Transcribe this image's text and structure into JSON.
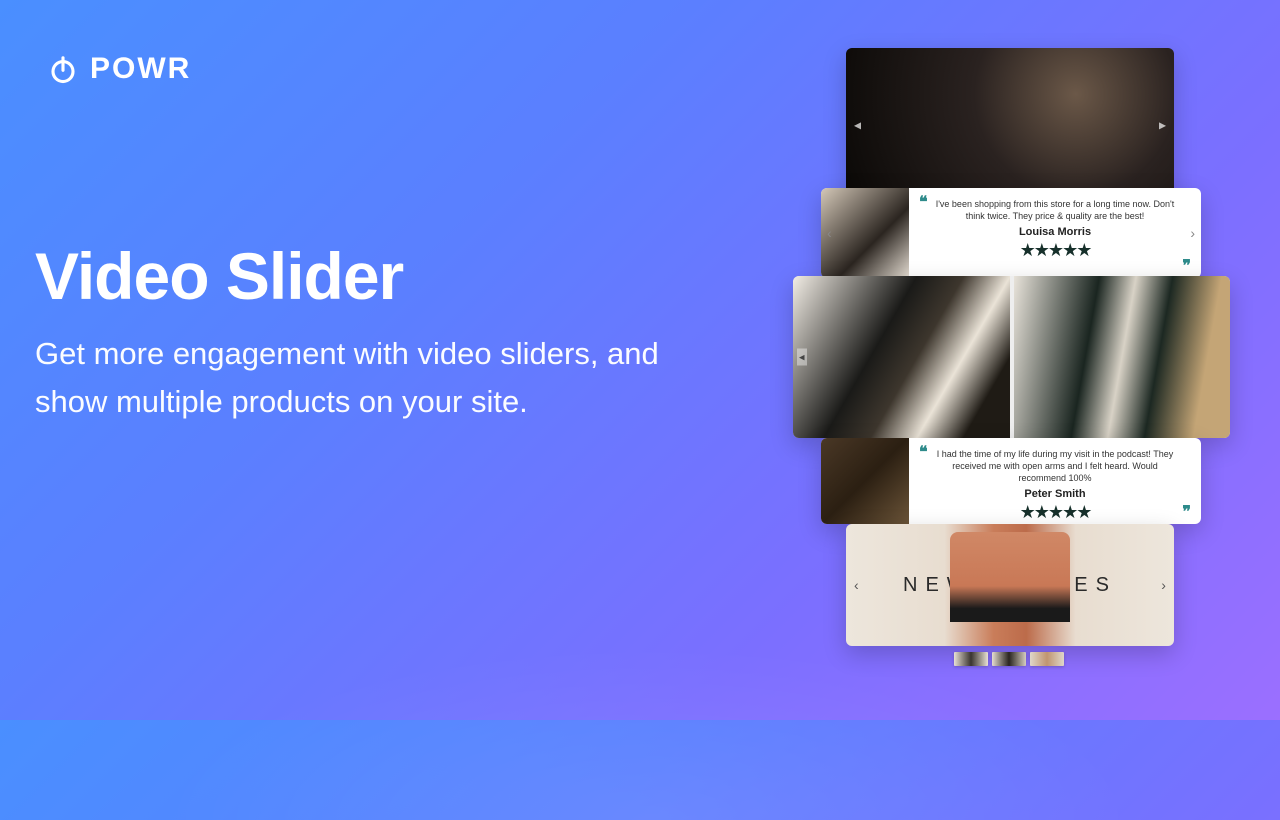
{
  "brand": {
    "name": "POWR"
  },
  "hero": {
    "title": "Video Slider",
    "subtitle": "Get more engagement with video sliders, and show multiple products on your site."
  },
  "testimonial1": {
    "text": "I've been shopping from this store for a long time now. Don't think twice. They price & quality are the best!",
    "name": "Louisa Morris",
    "stars": "★★★★★"
  },
  "testimonial2": {
    "text": "I had the time of my life during my visit in the podcast! They received me with open arms and I felt heard. Would recommend 100%",
    "name": "Peter Smith",
    "stars": "★★★★★"
  },
  "banner": {
    "left_word": "NEW",
    "right_word": "VIBES"
  },
  "nav": {
    "prev": "‹",
    "next": "›",
    "tri_l": "◂",
    "tri_r": "▸"
  },
  "quotes": {
    "open": "❝",
    "close": "❞"
  }
}
